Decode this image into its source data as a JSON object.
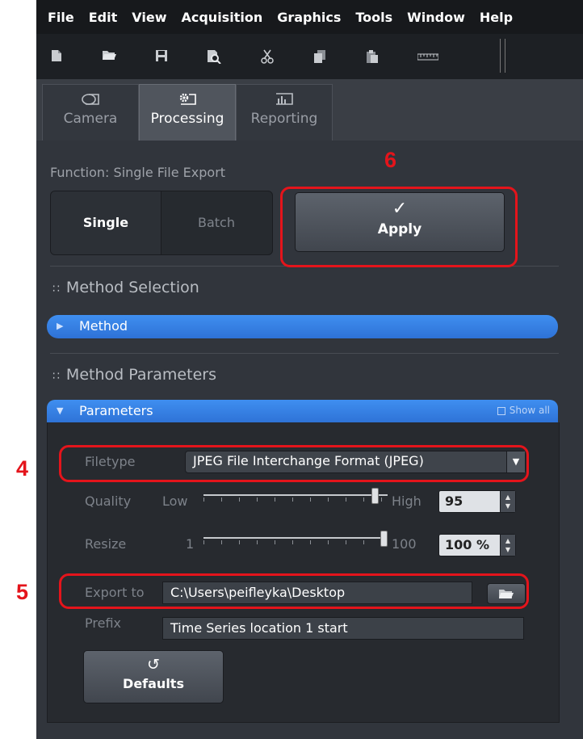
{
  "menu": [
    "File",
    "Edit",
    "View",
    "Acquisition",
    "Graphics",
    "Tools",
    "Window",
    "Help"
  ],
  "toolbar": {
    "icons": [
      "new-document-icon",
      "open-folder-icon",
      "save-icon",
      "print-preview-icon",
      "cut-icon",
      "copy-icon",
      "paste-icon",
      "ruler-icon"
    ]
  },
  "tabs": [
    {
      "label": "Camera",
      "icon": "camera-icon",
      "active": false
    },
    {
      "label": "Processing",
      "icon": "gear-icon",
      "active": true
    },
    {
      "label": "Reporting",
      "icon": "bar-chart-icon",
      "active": false
    }
  ],
  "function": {
    "label": "Function:  Single File Export",
    "mode_single": "Single",
    "mode_batch": "Batch",
    "selected_mode": "Single"
  },
  "apply": {
    "label": "Apply",
    "icon": "checkmark-icon"
  },
  "method_selection": {
    "title": "Method Selection",
    "method_label": "Method"
  },
  "method_parameters": {
    "title": "Method Parameters",
    "parameters_label": "Parameters",
    "show_all": "Show all"
  },
  "filetype": {
    "label": "Filetype",
    "value": "JPEG File Interchange Format (JPEG)"
  },
  "quality": {
    "label": "Quality",
    "min_label": "Low",
    "max_label": "High",
    "value": "95",
    "slider_fraction": 0.95
  },
  "resize": {
    "label": "Resize",
    "min_label": "1",
    "max_label": "100",
    "value": "100 %",
    "slider_fraction": 1.0
  },
  "export_to": {
    "label": "Export to",
    "value": "C:\\Users\\peifleyka\\Desktop"
  },
  "prefix": {
    "label": "Prefix",
    "value": "Time Series location 1 start"
  },
  "defaults": {
    "label": "Defaults",
    "icon": "undo-icon"
  },
  "annotations": {
    "n4": "4",
    "n5": "5",
    "n6": "6",
    "color": "#e4141b"
  },
  "colors": {
    "accent_blue": "#3f8ff0",
    "background": "#31353c"
  }
}
